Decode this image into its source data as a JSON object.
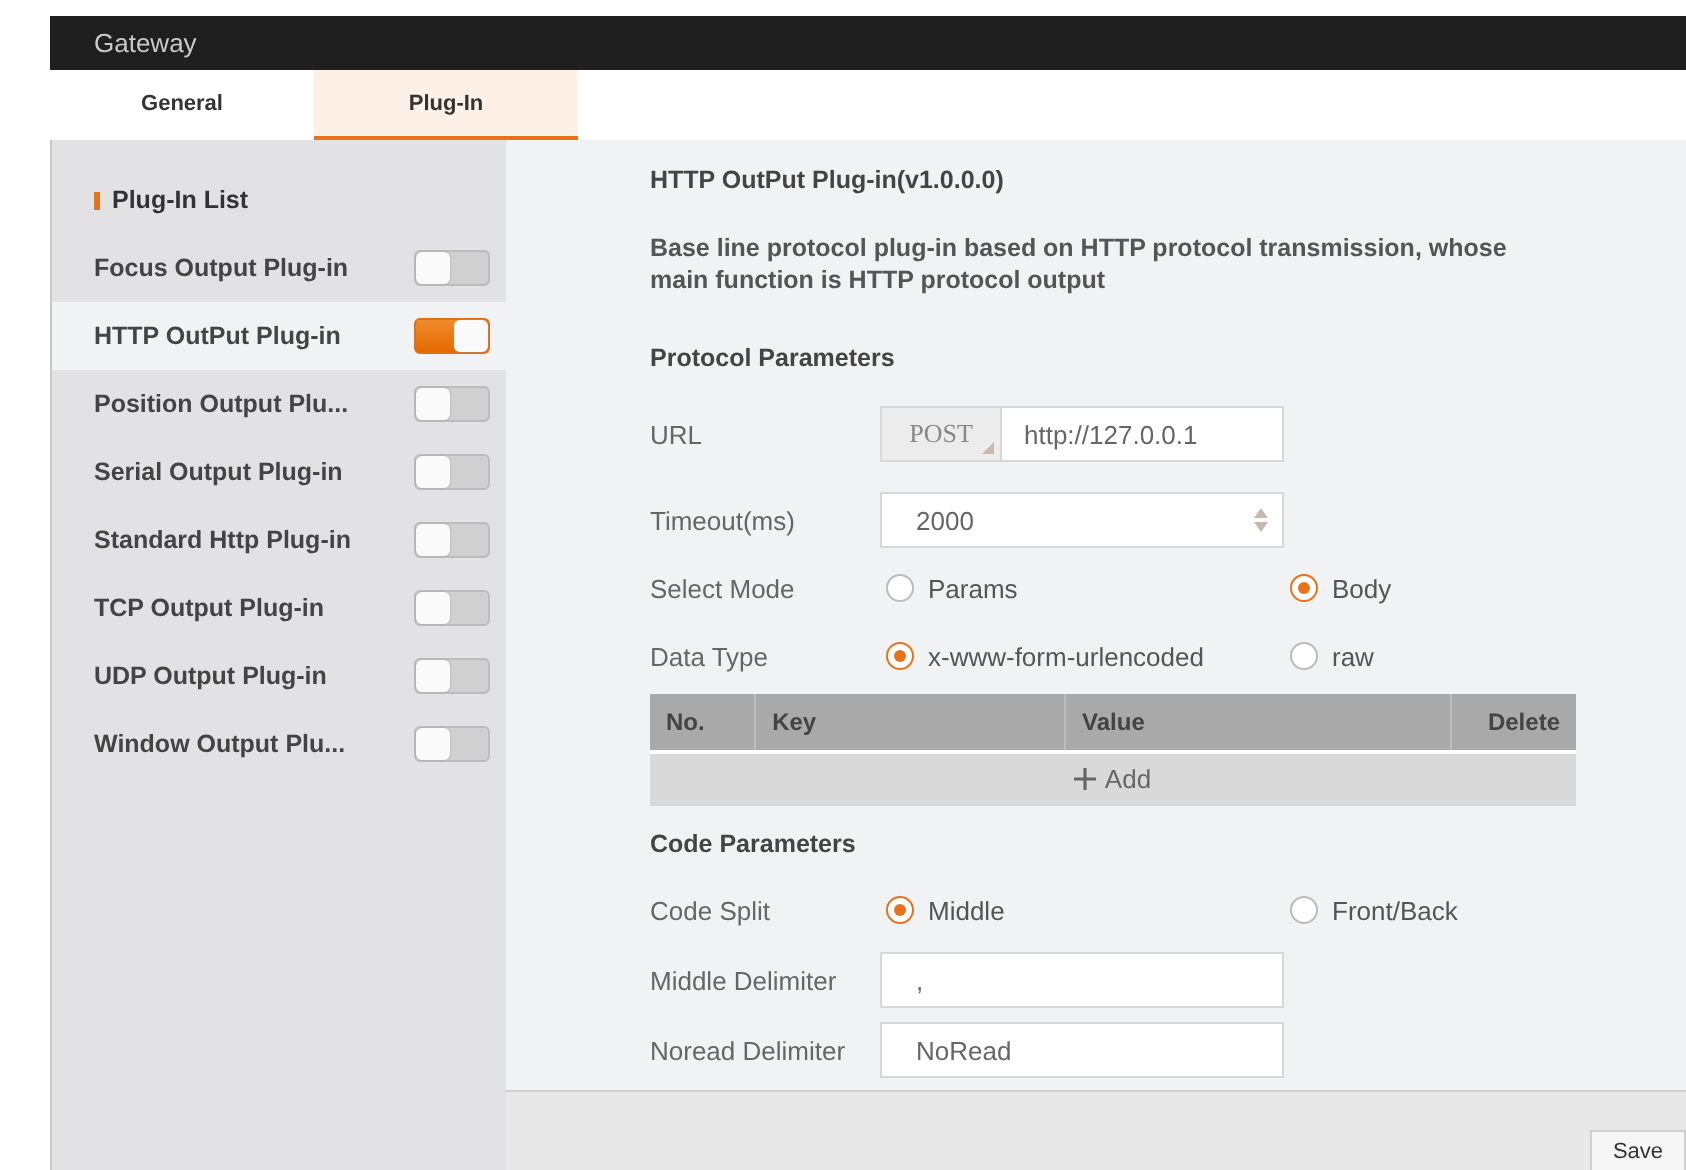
{
  "window": {
    "title": "Gateway"
  },
  "tabs": [
    {
      "label": "General",
      "selected": false
    },
    {
      "label": "Plug-In",
      "selected": true
    }
  ],
  "sidebar": {
    "heading": "Plug-In List",
    "items": [
      {
        "label": "Focus Output Plug-in",
        "on": false,
        "selected": false
      },
      {
        "label": "HTTP OutPut Plug-in",
        "on": true,
        "selected": true
      },
      {
        "label": "Position Output Plu...",
        "on": false,
        "selected": false
      },
      {
        "label": "Serial Output Plug-in",
        "on": false,
        "selected": false
      },
      {
        "label": "Standard Http Plug-in",
        "on": false,
        "selected": false
      },
      {
        "label": "TCP Output Plug-in",
        "on": false,
        "selected": false
      },
      {
        "label": "UDP Output Plug-in",
        "on": false,
        "selected": false
      },
      {
        "label": "Window Output Plu...",
        "on": false,
        "selected": false
      }
    ]
  },
  "detail": {
    "title": "HTTP OutPut Plug-in(v1.0.0.0)",
    "description": "Base line protocol plug-in based on HTTP protocol transmission, whose main function is HTTP protocol output",
    "sections": [
      {
        "heading": "Protocol Parameters",
        "rows": [
          {
            "kind": "url",
            "label": "URL",
            "method": "POST",
            "value": "http://127.0.0.1"
          },
          {
            "kind": "number",
            "label": "Timeout(ms)",
            "value": "2000"
          },
          {
            "kind": "radio",
            "label": "Select Mode",
            "options": [
              {
                "label": "Params",
                "selected": false
              },
              {
                "label": "Body",
                "selected": true
              }
            ]
          },
          {
            "kind": "radio",
            "label": "Data Type",
            "options": [
              {
                "label": "x-www-form-urlencoded",
                "selected": true
              },
              {
                "label": "raw",
                "selected": false
              }
            ]
          },
          {
            "kind": "table",
            "columns": [
              "No.",
              "Key",
              "Value",
              "Delete"
            ],
            "add_label": "Add"
          }
        ]
      },
      {
        "heading": "Code Parameters",
        "rows": [
          {
            "kind": "radio",
            "label": "Code Split",
            "options": [
              {
                "label": "Middle",
                "selected": true
              },
              {
                "label": "Front/Back",
                "selected": false
              }
            ]
          },
          {
            "kind": "text",
            "label": "Middle Delimiter",
            "value": ","
          },
          {
            "kind": "text",
            "label": "Noread Delimiter",
            "value": "NoRead"
          }
        ]
      }
    ]
  },
  "footer": {
    "save": "Save"
  }
}
